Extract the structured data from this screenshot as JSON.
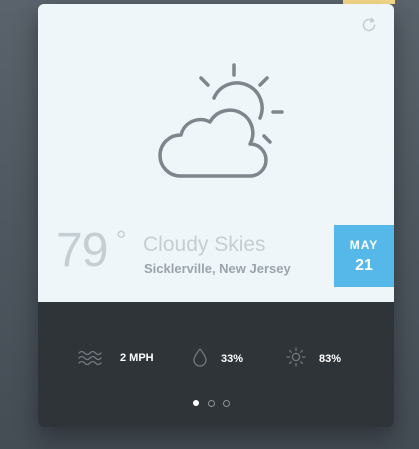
{
  "weather": {
    "temperature": "79",
    "degree_symbol": "°",
    "condition": "Cloudy Skies",
    "location": "Sicklerville, New Jersey",
    "icon": "partly-cloudy-icon"
  },
  "date": {
    "month": "MAY",
    "day": "21"
  },
  "stats": {
    "wind": {
      "icon": "wind-waves-icon",
      "value": "2 MPH"
    },
    "humidity": {
      "icon": "droplet-icon",
      "value": "33%"
    },
    "uv": {
      "icon": "sun-icon",
      "value": "83%"
    }
  },
  "pagination": {
    "pages": 3,
    "active": 1
  },
  "colors": {
    "accent": "#56b8e8",
    "card_top": "#eef6f9",
    "card_bottom": "#2f3438",
    "icon_stroke": "#7d868c"
  }
}
